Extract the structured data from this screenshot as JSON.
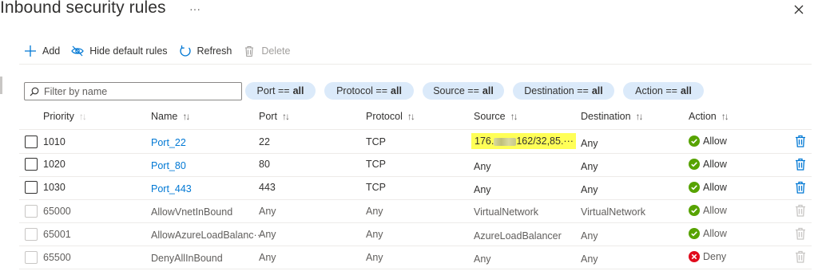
{
  "header": {
    "title": "Inbound security rules",
    "more_label": "···"
  },
  "toolbar": {
    "add_label": "Add",
    "hide_default_label": "Hide default rules",
    "refresh_label": "Refresh",
    "delete_label": "Delete"
  },
  "filters": {
    "search_placeholder": "Filter by name",
    "pills": [
      {
        "key": "Port",
        "op": "==",
        "value": "all"
      },
      {
        "key": "Protocol",
        "op": "==",
        "value": "all"
      },
      {
        "key": "Source",
        "op": "==",
        "value": "all"
      },
      {
        "key": "Destination",
        "op": "==",
        "value": "all"
      },
      {
        "key": "Action",
        "op": "==",
        "value": "all"
      }
    ]
  },
  "table": {
    "columns": [
      "Priority",
      "Name",
      "Port",
      "Protocol",
      "Source",
      "Destination",
      "Action"
    ],
    "rows": [
      {
        "priority": "1010",
        "name": "Port_22",
        "port": "22",
        "protocol": "TCP",
        "source_prefix": "176.",
        "source_suffix": "162/32,85.···",
        "destination": "Any",
        "action": "Allow",
        "editable": true
      },
      {
        "priority": "1020",
        "name": "Port_80",
        "port": "80",
        "protocol": "TCP",
        "source": "Any",
        "destination": "Any",
        "action": "Allow",
        "editable": true
      },
      {
        "priority": "1030",
        "name": "Port_443",
        "port": "443",
        "protocol": "TCP",
        "source": "Any",
        "destination": "Any",
        "action": "Allow",
        "editable": true
      },
      {
        "priority": "65000",
        "name": "AllowVnetInBound",
        "port": "Any",
        "protocol": "Any",
        "source": "VirtualNetwork",
        "destination": "VirtualNetwork",
        "action": "Allow",
        "editable": false
      },
      {
        "priority": "65001",
        "name": "AllowAzureLoadBalanc···",
        "port": "Any",
        "protocol": "Any",
        "source": "AzureLoadBalancer",
        "destination": "Any",
        "action": "Allow",
        "editable": false
      },
      {
        "priority": "65500",
        "name": "DenyAllInBound",
        "port": "Any",
        "protocol": "Any",
        "source": "Any",
        "destination": "Any",
        "action": "Deny",
        "editable": false
      }
    ]
  },
  "colors": {
    "accent": "#0078d4",
    "allow": "#57a300",
    "deny": "#e00b1c",
    "highlight": "#ffff57",
    "pill_bg": "#dbeafa"
  }
}
